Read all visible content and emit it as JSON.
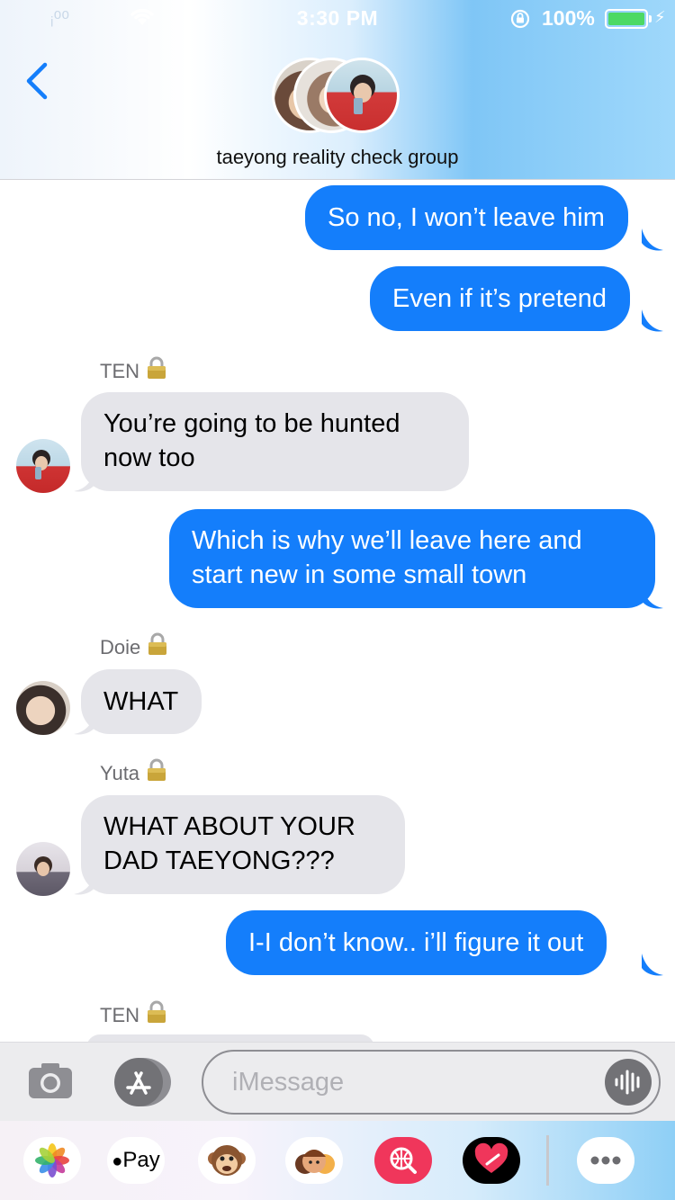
{
  "status_bar": {
    "carrier": "ᵢ⁰⁰",
    "time": "3:30 PM",
    "battery_percent": "100%",
    "battery_level": 1.0
  },
  "header": {
    "group_name": "taeyong reality check group"
  },
  "messages": [
    {
      "type": "outgoing",
      "text": "So no, I won’t leave him"
    },
    {
      "type": "outgoing",
      "text": "Even if it’s pretend"
    },
    {
      "type": "sender",
      "text": "TEN"
    },
    {
      "type": "incoming",
      "lines": [
        "You’re going to be hunted",
        "now too"
      ]
    },
    {
      "type": "outgoing",
      "lines": [
        "Which is why we’ll leave here and",
        "start new in some small town"
      ]
    },
    {
      "type": "sender",
      "text": "Doie"
    },
    {
      "type": "incoming",
      "text": "WHAT"
    },
    {
      "type": "sender",
      "text": "Yuta"
    },
    {
      "type": "incoming",
      "lines": [
        "WHAT ABOUT YOUR",
        "DAD TAEYONG???"
      ]
    },
    {
      "type": "outgoing",
      "text": "I-I don’t know.. i’ll figure it out"
    },
    {
      "type": "sender",
      "text": "TEN"
    }
  ],
  "composer": {
    "placeholder": "iMessage"
  },
  "app_drawer": {
    "apps": [
      "photos-icon",
      "apple-pay-icon",
      "monkey-animoji-icon",
      "memoji-icon",
      "web-search-icon",
      "digital-touch-icon",
      "more-icon"
    ],
    "apple_pay_label": "Pay"
  },
  "colors": {
    "outgoing_bubble": "#147efb",
    "incoming_bubble": "#e5e5ea",
    "accent": "#147efb"
  }
}
